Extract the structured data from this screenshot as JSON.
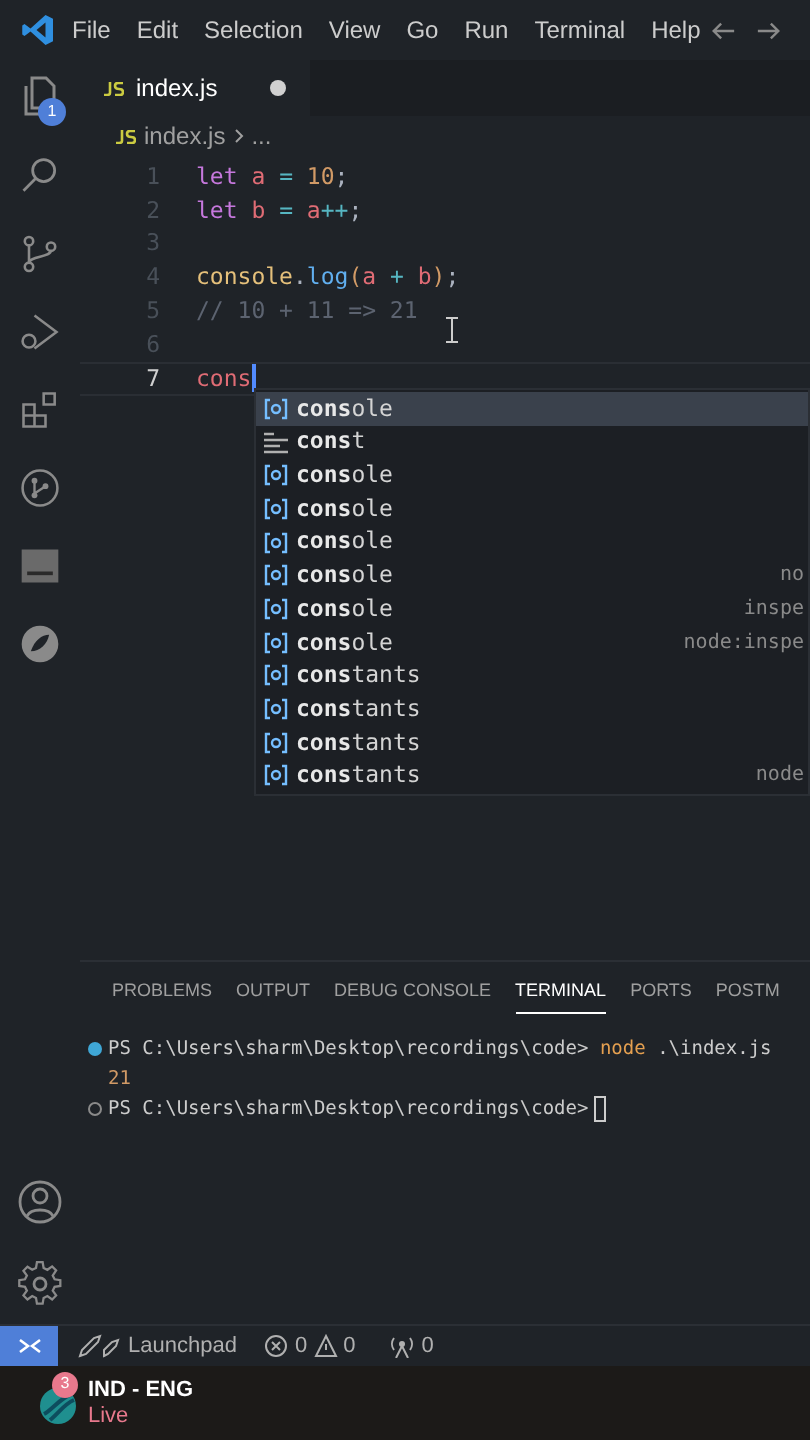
{
  "menu": [
    "File",
    "Edit",
    "Selection",
    "View",
    "Go",
    "Run",
    "Terminal",
    "Help"
  ],
  "activity_bar": {
    "explorer_badge": "1"
  },
  "editor_tab": {
    "label": "index.js",
    "modified": true
  },
  "breadcrumb": {
    "file": "index.js",
    "rest": "..."
  },
  "code_lines": [
    {
      "number": "1",
      "current": false,
      "tokens": [
        {
          "kind": "keyword",
          "text": "let "
        },
        {
          "kind": "variable",
          "text": "a"
        },
        {
          "kind": "operator",
          "text": " = "
        },
        {
          "kind": "number",
          "text": "10"
        },
        {
          "kind": "plain",
          "text": ";"
        }
      ]
    },
    {
      "number": "2",
      "current": false,
      "tokens": [
        {
          "kind": "keyword",
          "text": "let "
        },
        {
          "kind": "variable",
          "text": "b"
        },
        {
          "kind": "operator",
          "text": " = "
        },
        {
          "kind": "variable",
          "text": "a"
        },
        {
          "kind": "operator",
          "text": "++"
        },
        {
          "kind": "plain",
          "text": ";"
        }
      ]
    },
    {
      "number": "3",
      "current": false
    },
    {
      "number": "4",
      "current": false,
      "tokens": [
        {
          "kind": "object",
          "text": "console"
        },
        {
          "kind": "plain",
          "text": "."
        },
        {
          "kind": "function",
          "text": "log"
        },
        {
          "kind": "paren",
          "text": "("
        },
        {
          "kind": "variable",
          "text": "a"
        },
        {
          "kind": "operator",
          "text": " + "
        },
        {
          "kind": "variable",
          "text": "b"
        },
        {
          "kind": "paren",
          "text": ")"
        },
        {
          "kind": "plain",
          "text": ";"
        }
      ]
    },
    {
      "number": "5",
      "current": false,
      "tokens": [
        {
          "kind": "comment",
          "text": "// 10 + 11 => 21"
        }
      ]
    },
    {
      "number": "6",
      "current": false
    },
    {
      "number": "7",
      "current": true,
      "tokens": [
        {
          "kind": "variable",
          "text": "cons"
        }
      ]
    }
  ],
  "suggestions": [
    {
      "kind": "variable",
      "match": "cons",
      "rest": "ole",
      "selected": true
    },
    {
      "kind": "snippet",
      "match": "cons",
      "rest": "t",
      "selected": false
    },
    {
      "kind": "variable",
      "match": "cons",
      "rest": "ole",
      "selected": false
    },
    {
      "kind": "variable",
      "match": "cons",
      "rest": "ole",
      "selected": false
    },
    {
      "kind": "variable",
      "match": "cons",
      "rest": "ole",
      "selected": false
    },
    {
      "kind": "variable",
      "match": "cons",
      "rest": "ole",
      "detail": "no",
      "selected": false
    },
    {
      "kind": "variable",
      "match": "cons",
      "rest": "ole",
      "detail": "inspe",
      "selected": false
    },
    {
      "kind": "variable",
      "match": "cons",
      "rest": "ole",
      "detail": "node:inspe",
      "selected": false
    },
    {
      "kind": "variable",
      "match": "cons",
      "rest": "tants",
      "selected": false
    },
    {
      "kind": "variable",
      "match": "cons",
      "rest": "tants",
      "selected": false
    },
    {
      "kind": "variable",
      "match": "cons",
      "rest": "tants",
      "selected": false
    },
    {
      "kind": "variable",
      "match": "cons",
      "rest": "tants",
      "detail": "node",
      "selected": false
    }
  ],
  "panel_tabs": [
    {
      "label": "PROBLEMS",
      "selected": false
    },
    {
      "label": "OUTPUT",
      "selected": false
    },
    {
      "label": "DEBUG CONSOLE",
      "selected": false
    },
    {
      "label": "TERMINAL",
      "selected": true
    },
    {
      "label": "PORTS",
      "selected": false
    },
    {
      "label": "POSTM",
      "selected": false
    }
  ],
  "terminal": [
    {
      "kind": "command",
      "finished": true,
      "prompt": "PS C:\\Users\\sharm\\Desktop\\recordings\\code>",
      "command": "node",
      "args": ".\\index.js"
    },
    {
      "kind": "output",
      "text": "21"
    },
    {
      "kind": "command",
      "finished": false,
      "prompt": "PS C:\\Users\\sharm\\Desktop\\recordings\\code>",
      "cursor": true
    }
  ],
  "status_bar": {
    "launchpad": "Launchpad",
    "errors": "0",
    "warnings": "0",
    "ports": "0"
  },
  "taskbar": {
    "badge": "3",
    "title": "IND - ENG",
    "subtitle": "Live"
  }
}
